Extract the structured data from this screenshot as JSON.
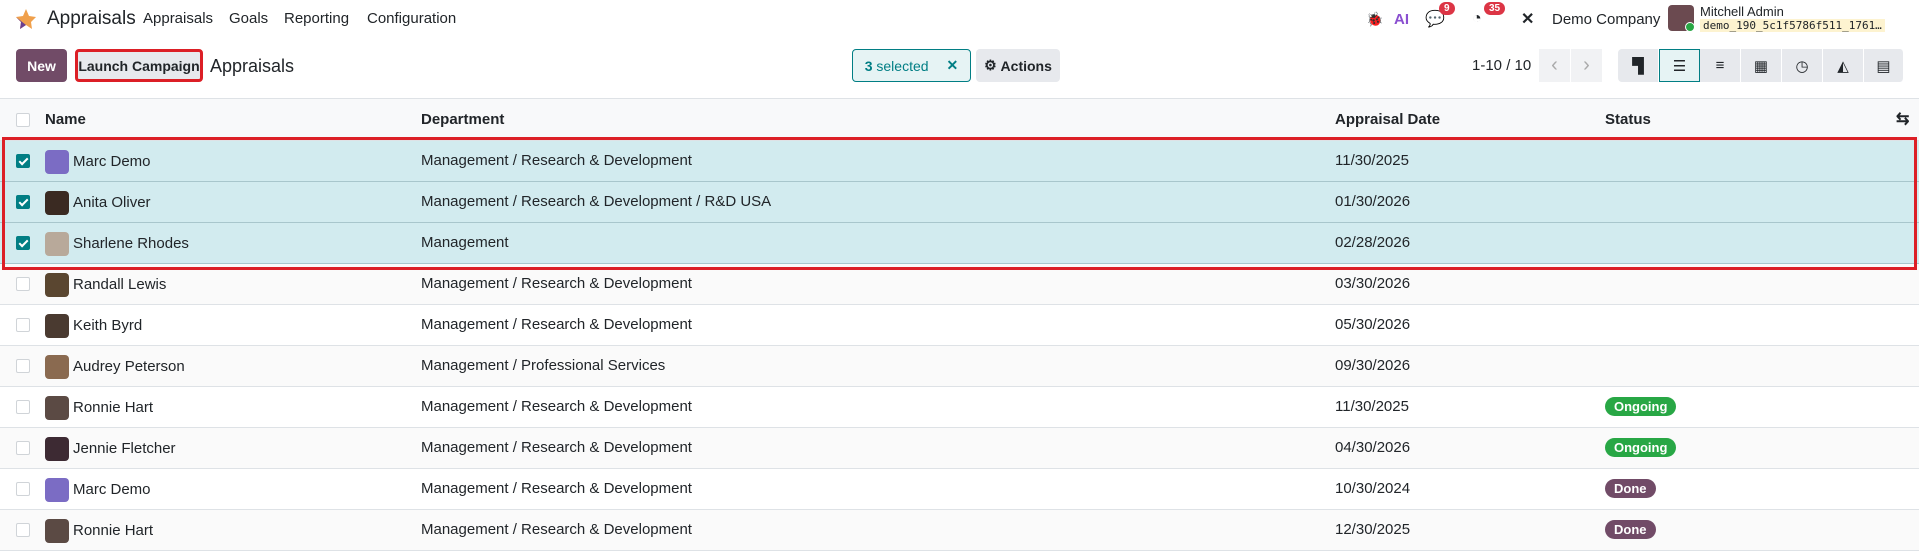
{
  "navbar": {
    "app_name": "Appraisals",
    "menu": [
      "Appraisals",
      "Goals",
      "Reporting",
      "Configuration"
    ],
    "messages_count": "9",
    "activities_count": "35",
    "company": "Demo Company",
    "user_name": "Mitchell Admin",
    "database": "demo_190_5c1f5786f511_1761…"
  },
  "control_panel": {
    "new_label": "New",
    "launch_label": "Launch Campaign",
    "title": "Appraisals",
    "selected_count": "3",
    "selected_label": "selected",
    "actions_label": "Actions",
    "pager": "1-10 / 10"
  },
  "columns": {
    "name": "Name",
    "department": "Department",
    "date": "Appraisal Date",
    "status": "Status"
  },
  "rows": [
    {
      "name": "Marc Demo",
      "department": "Management / Research & Development",
      "date": "11/30/2025",
      "status": "",
      "selected": true
    },
    {
      "name": "Anita Oliver",
      "department": "Management / Research & Development / R&D USA",
      "date": "01/30/2026",
      "status": "",
      "selected": true
    },
    {
      "name": "Sharlene Rhodes",
      "department": "Management",
      "date": "02/28/2026",
      "status": "",
      "selected": true
    },
    {
      "name": "Randall Lewis",
      "department": "Management / Research & Development",
      "date": "03/30/2026",
      "status": "",
      "selected": false
    },
    {
      "name": "Keith Byrd",
      "department": "Management / Research & Development",
      "date": "05/30/2026",
      "status": "",
      "selected": false
    },
    {
      "name": "Audrey Peterson",
      "department": "Management / Professional Services",
      "date": "09/30/2026",
      "status": "",
      "selected": false
    },
    {
      "name": "Ronnie Hart",
      "department": "Management / Research & Development",
      "date": "11/30/2025",
      "status": "Ongoing",
      "selected": false
    },
    {
      "name": "Jennie Fletcher",
      "department": "Management / Research & Development",
      "date": "04/30/2026",
      "status": "Ongoing",
      "selected": false
    },
    {
      "name": "Marc Demo",
      "department": "Management / Research & Development",
      "date": "10/30/2024",
      "status": "Done",
      "selected": false
    },
    {
      "name": "Ronnie Hart",
      "department": "Management / Research & Development",
      "date": "12/30/2025",
      "status": "Done",
      "selected": false
    }
  ],
  "colors": {
    "primary": "#714b67",
    "teal": "#017e84",
    "ongoing": "#28a745",
    "done": "#714b67",
    "selected_row": "#d2ebef"
  }
}
